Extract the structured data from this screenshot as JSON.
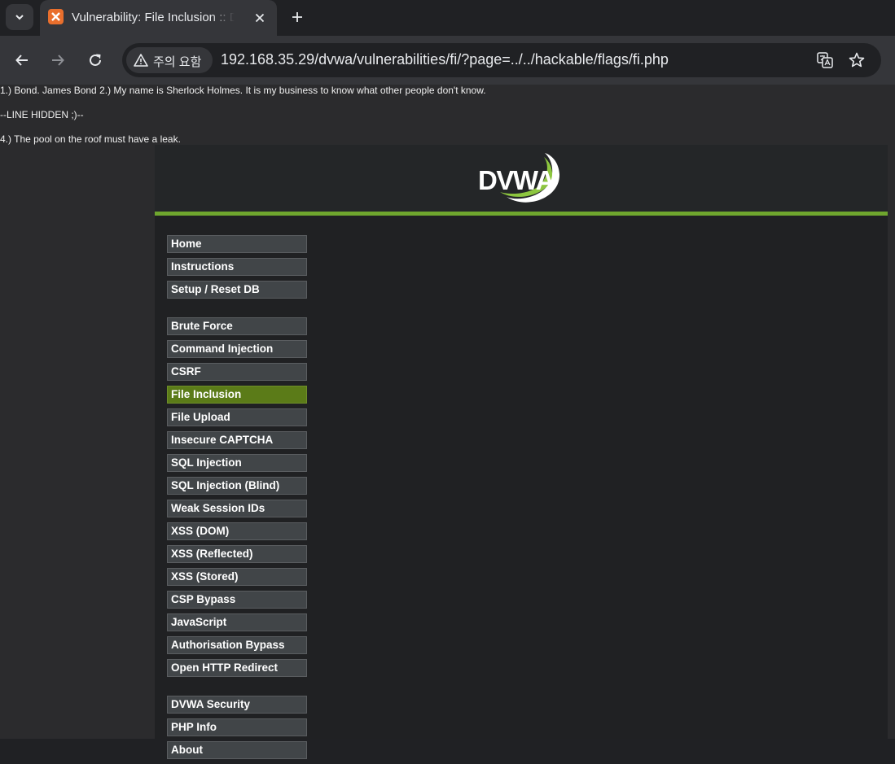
{
  "browser": {
    "tab_title": "Vulnerability: File Inclusion :: Damn Vulnerable Web Application (DVWA)",
    "security_label": "주의 요함",
    "url": "192.168.35.29/dvwa/vulnerabilities/fi/?page=../../hackable/flags/fi.php"
  },
  "included_file": {
    "line1": "1.) Bond. James Bond 2.) My name is Sherlock Holmes. It is my business to know what other people don't know.",
    "line2": "--LINE HIDDEN ;)--",
    "line3": "4.) The pool on the roof must have a leak."
  },
  "logo": {
    "text": "DVWA"
  },
  "menu": {
    "group1": [
      {
        "label": "Home"
      },
      {
        "label": "Instructions"
      },
      {
        "label": "Setup / Reset DB"
      }
    ],
    "group2": [
      {
        "label": "Brute Force"
      },
      {
        "label": "Command Injection"
      },
      {
        "label": "CSRF"
      },
      {
        "label": "File Inclusion"
      },
      {
        "label": "File Upload"
      },
      {
        "label": "Insecure CAPTCHA"
      },
      {
        "label": "SQL Injection"
      },
      {
        "label": "SQL Injection (Blind)"
      },
      {
        "label": "Weak Session IDs"
      },
      {
        "label": "XSS (DOM)"
      },
      {
        "label": "XSS (Reflected)"
      },
      {
        "label": "XSS (Stored)"
      },
      {
        "label": "CSP Bypass"
      },
      {
        "label": "JavaScript"
      },
      {
        "label": "Authorisation Bypass"
      },
      {
        "label": "Open HTTP Redirect"
      }
    ],
    "group3": [
      {
        "label": "DVWA Security"
      },
      {
        "label": "PHP Info"
      },
      {
        "label": "About"
      }
    ],
    "selected": "File Inclusion"
  },
  "colors": {
    "accent": "#6fa62e",
    "selected_item": "#5b7b18",
    "menu_item": "#414548"
  },
  "icons": {
    "tab_list": "chevron-down-icon",
    "favicon": "xampp-icon",
    "close": "close-icon",
    "new_tab": "plus-icon",
    "back": "back-arrow-icon",
    "forward": "forward-arrow-icon",
    "reload": "reload-icon",
    "warning": "warning-icon",
    "translate": "translate-icon",
    "bookmark": "star-icon"
  }
}
